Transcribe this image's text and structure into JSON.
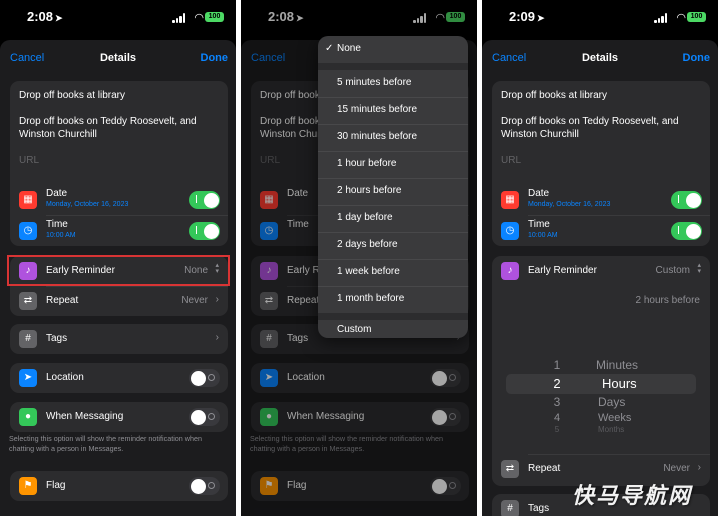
{
  "colors": {
    "accent": "#0a84ff",
    "toggle_on": "#34c759",
    "highlight": "#d93434"
  },
  "phone1": {
    "status": {
      "time": "2:08",
      "battery": "100"
    },
    "nav": {
      "cancel": "Cancel",
      "title": "Details",
      "done": "Done"
    },
    "title_text": "Drop off books at library",
    "notes_text": "Drop off books on Teddy Roosevelt, and Winston Churchill",
    "url_placeholder": "URL",
    "date": {
      "label": "Date",
      "value": "Monday, October 16, 2023",
      "on": true
    },
    "time_row": {
      "label": "Time",
      "value": "10:00 AM",
      "on": true
    },
    "early_reminder": {
      "label": "Early Reminder",
      "value": "None"
    },
    "repeat": {
      "label": "Repeat",
      "value": "Never"
    },
    "tags": {
      "label": "Tags"
    },
    "location": {
      "label": "Location",
      "on": false
    },
    "messaging": {
      "label": "When Messaging",
      "on": false,
      "footnote": "Selecting this option will show the reminder notification when chatting with a person in Messages."
    },
    "flag": {
      "label": "Flag",
      "on": false
    }
  },
  "phone2": {
    "status": {
      "time": "2:08",
      "battery": "100"
    },
    "nav": {
      "cancel": "Cancel",
      "title": "Details"
    },
    "title_text": "Drop off books at library",
    "notes_text": "Drop off books on Teddy Roosevelt, and Winston Churchill",
    "url_placeholder": "URL",
    "date_label": "Date",
    "time_label": "Time",
    "early_label": "Early Reminder",
    "repeat_label": "Repeat",
    "tags_label": "Tags",
    "location_label": "Location",
    "messaging_label": "When Messaging",
    "footnote": "Selecting this option will show the reminder notification when chatting with a person in Messages.",
    "flag_label": "Flag",
    "menu": {
      "selected": "None",
      "items": [
        "5 minutes before",
        "15 minutes before",
        "30 minutes before",
        "1 hour before",
        "2 hours before",
        "1 day before",
        "2 days before",
        "1 week before",
        "1 month before"
      ],
      "custom": "Custom"
    }
  },
  "phone3": {
    "status": {
      "time": "2:09",
      "battery": "100"
    },
    "nav": {
      "cancel": "Cancel",
      "title": "Details",
      "done": "Done"
    },
    "title_text": "Drop off books at library",
    "notes_text": "Drop off books on Teddy Roosevelt, and Winston Churchill",
    "url_placeholder": "URL",
    "date": {
      "label": "Date",
      "value": "Monday, October 16, 2023"
    },
    "time_row": {
      "label": "Time",
      "value": "10:00 AM"
    },
    "early_reminder": {
      "label": "Early Reminder",
      "value": "Custom",
      "summary": "2 hours before"
    },
    "picker": {
      "numbers": [
        "1",
        "2",
        "3",
        "4",
        "5"
      ],
      "units": [
        "Minutes",
        "Hours",
        "Days",
        "Weeks",
        "Months"
      ],
      "selected_number": "2",
      "selected_unit": "Hours"
    },
    "repeat": {
      "label": "Repeat",
      "value": "Never"
    },
    "tags": {
      "label": "Tags"
    }
  },
  "watermark": "快马导航网"
}
